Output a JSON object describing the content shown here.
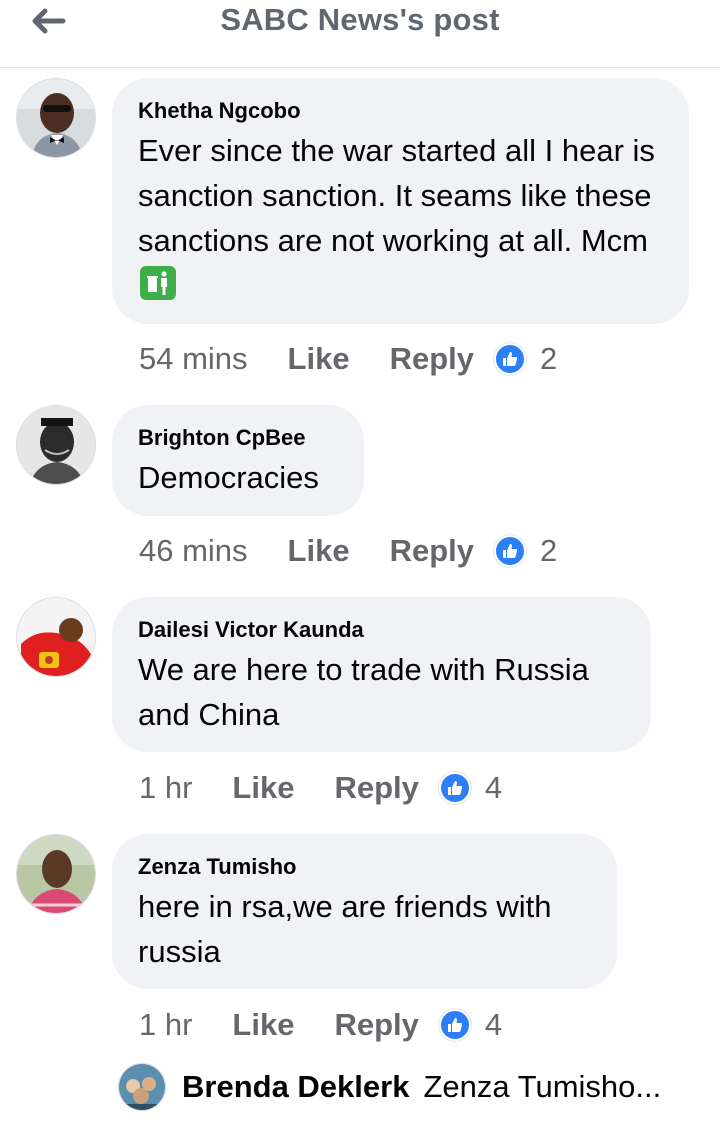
{
  "header": {
    "title": "SABC News's post"
  },
  "comments": [
    {
      "author": "Khetha Ngcobo",
      "text": "Ever since the war started all I hear is sanction sanction. It seams like these sanctions are not working at all. Mcm",
      "time": "54 mins",
      "like": "Like",
      "reply": "Reply",
      "reactions": "2"
    },
    {
      "author": "Brighton CpBee",
      "text": "Democracies",
      "time": "46 mins",
      "like": "Like",
      "reply": "Reply",
      "reactions": "2"
    },
    {
      "author": "Dailesi Victor Kaunda",
      "text": "We are here to trade with Russia and China",
      "time": "1 hr",
      "like": "Like",
      "reply": "Reply",
      "reactions": "4"
    },
    {
      "author": "Zenza Tumisho",
      "text": "here in rsa,we are friends with russia",
      "time": "1 hr",
      "like": "Like",
      "reply": "Reply",
      "reactions": "4"
    }
  ],
  "reply_preview": {
    "author": "Brenda Deklerk",
    "text": "Zenza Tumisho..."
  },
  "colors": {
    "bubble": "#f0f2f5",
    "like_blue": "#2d7ff9",
    "muted_text": "#65676b",
    "header_text": "#606770"
  }
}
